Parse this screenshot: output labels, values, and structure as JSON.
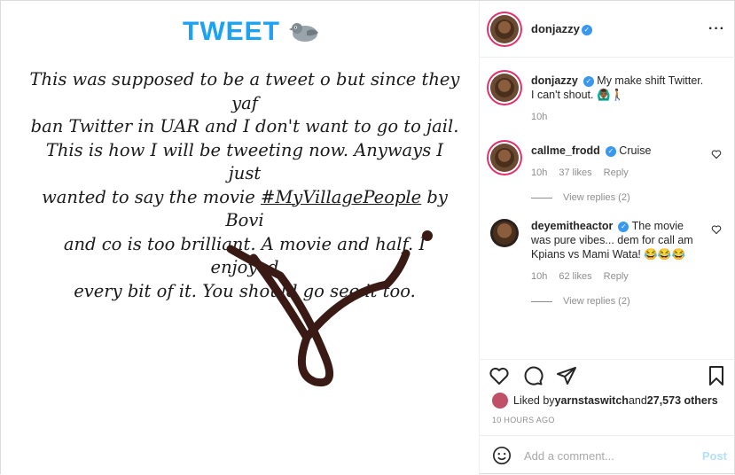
{
  "media": {
    "title": "TWEET",
    "title_icon": "pigeon-icon",
    "lines": [
      "This was supposed to be a tweet o but since they yaf",
      "ban Twitter in UAR and I don't want to go to jail.",
      "This is how I will be tweeting now. Anyways I just"
    ],
    "line4_before": "wanted to say the movie ",
    "line4_tag": "#MyVillagePeople",
    "line4_after": " by Bovi",
    "lines_end": [
      "and co is too brilliant.  A movie and half. I enjoyed",
      "every bit of it. You should go see it too."
    ],
    "colors": {
      "title": "#1da1f2",
      "signature": "#3a1a14"
    }
  },
  "header": {
    "username": "donjazzy",
    "verified_icon": "verified-badge-icon",
    "more_icon": "more-options-icon"
  },
  "caption": {
    "username": "donjazzy",
    "text": "My make shift Twitter. I can't shout. 🙆🏾‍♂️🚶🏾",
    "time": "10h"
  },
  "comments": [
    {
      "username": "callme_frodd",
      "text": "Cruise",
      "time": "10h",
      "likes": "37 likes",
      "reply": "Reply",
      "view_replies": "View replies (2)"
    },
    {
      "username": "deyemitheactor",
      "text": "The movie was pure vibes... dem for call am Kpians vs Mami Wata! 😂😂😂",
      "time": "10h",
      "likes": "62 likes",
      "reply": "Reply",
      "view_replies": "View replies (2)"
    }
  ],
  "likes": {
    "prefix": "Liked by ",
    "user": "yarnstaswitch",
    "middle": " and ",
    "count": "27,573 others"
  },
  "time_ago": "10 HOURS AGO",
  "add_comment": {
    "placeholder": "Add a comment...",
    "post_label": "Post"
  }
}
